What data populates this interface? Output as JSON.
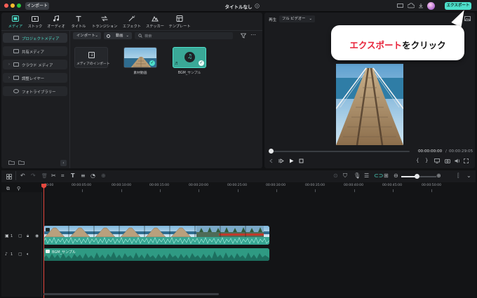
{
  "titlebar": {
    "import_tab": "インポート",
    "title": "タイトルなし",
    "export_label": "エクスポート"
  },
  "media_tabs": [
    {
      "label": "メディア",
      "icon": "media-icon",
      "active": true
    },
    {
      "label": "ストック",
      "icon": "stock-icon"
    },
    {
      "label": "オーディオ",
      "icon": "music-note-icon"
    },
    {
      "label": "タイトル",
      "icon": "title-t-icon"
    },
    {
      "label": "トランジション",
      "icon": "transition-icon"
    },
    {
      "label": "エフェクト",
      "icon": "effects-icon"
    },
    {
      "label": "ステッカー",
      "icon": "sticker-icon"
    },
    {
      "label": "テンプレート",
      "icon": "template-icon"
    }
  ],
  "sidebar": {
    "items": [
      {
        "label": "プロジェクトメディア",
        "active": true
      },
      {
        "label": "共有メディア"
      },
      {
        "label": "クラウド メディア"
      },
      {
        "label": "調整レイヤー"
      },
      {
        "label": "フォトライブラリー"
      }
    ]
  },
  "media_toolbar": {
    "import_label": "インポート",
    "filter_label": "動画",
    "search_placeholder": "検索"
  },
  "media_items": [
    {
      "label": "メディアのインポート"
    },
    {
      "label": "素材動画"
    },
    {
      "label": "BGM_サンプル"
    }
  ],
  "preview": {
    "label": "再生",
    "quality": "フル ビデオー",
    "current_time": "00:00:00:00",
    "separator": "/",
    "total_time": "00:00:29:05"
  },
  "callout": {
    "text_red": "エクスポート",
    "text_black": "をクリック"
  },
  "timeline": {
    "ruler_labels": [
      "00:00",
      "00:00:05:00",
      "00:00:10:00",
      "00:00:15:00",
      "00:00:20:00",
      "00:00:25:00",
      "00:00:30:00",
      "00:00:35:00",
      "00:00:40:00",
      "00:00:45:00",
      "00:00:50:00"
    ],
    "video_track_label": "1",
    "audio_track_label": "1",
    "audio_clip_label": "BGM_サンプル"
  },
  "colors": {
    "accent": "#4ee0cb",
    "callout_red": "#e8233a",
    "playhead": "#e5483e"
  }
}
